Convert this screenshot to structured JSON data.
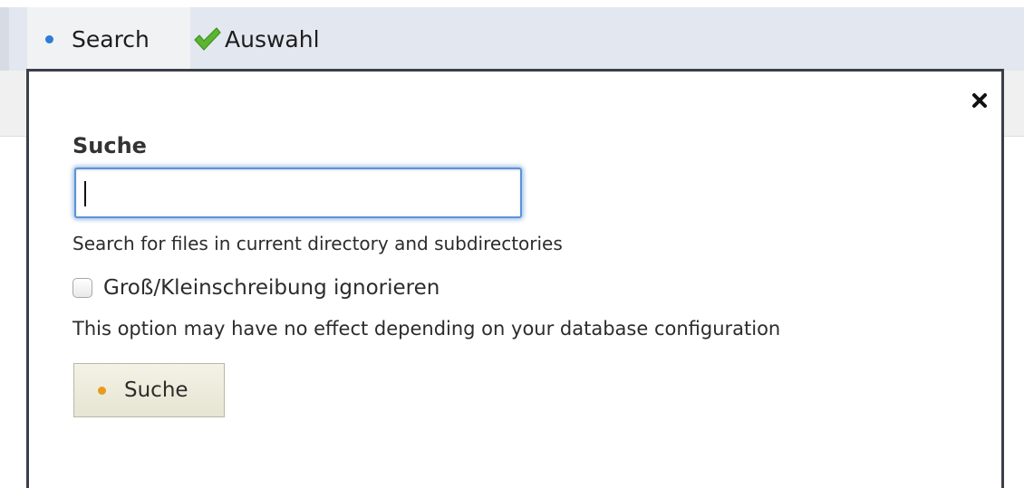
{
  "tabs": {
    "search_label": "Search",
    "auswahl_label": "Auswahl"
  },
  "dialog": {
    "title": "Suche",
    "search_value": "",
    "search_help": "Search for files in current directory and subdirectories",
    "case_checkbox_label": "Groß/Kleinschreibung ignorieren",
    "case_checkbox_checked": false,
    "option_note": "This option may have no effect depending on your database configuration",
    "submit_label": "Suche",
    "close_icon": "close-icon"
  },
  "colors": {
    "tab_dot": "#2f7bd6",
    "submit_dot": "#e89a1e",
    "check_icon": "#5cb531",
    "input_focus": "#5b93d9"
  }
}
